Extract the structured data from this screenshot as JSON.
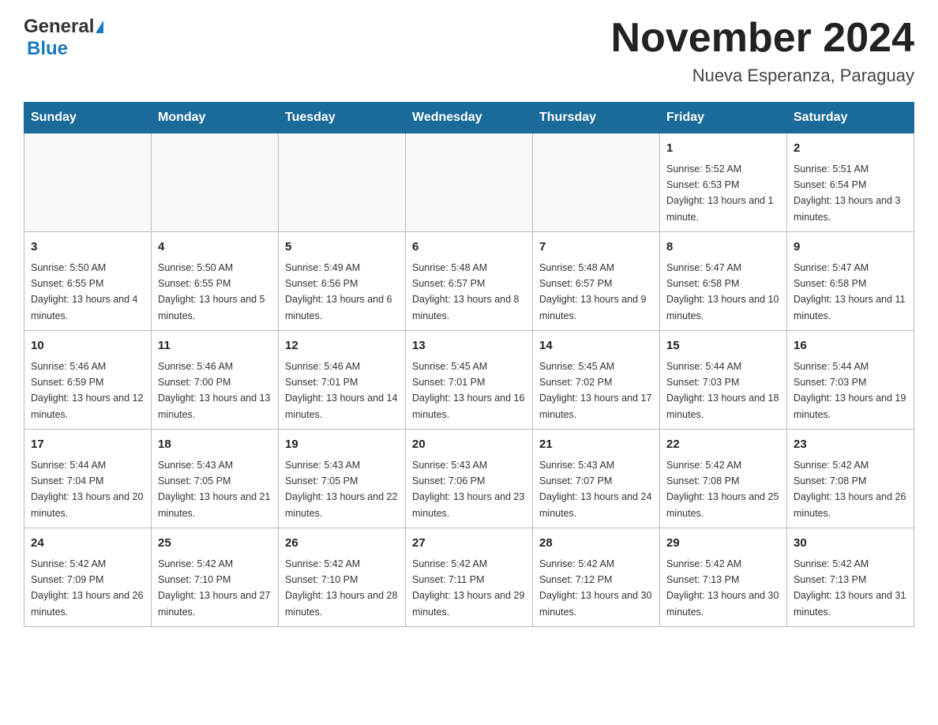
{
  "header": {
    "logo_general": "General",
    "logo_blue": "Blue",
    "month_title": "November 2024",
    "location": "Nueva Esperanza, Paraguay"
  },
  "weekdays": [
    "Sunday",
    "Monday",
    "Tuesday",
    "Wednesday",
    "Thursday",
    "Friday",
    "Saturday"
  ],
  "weeks": [
    [
      {
        "day": "",
        "info": ""
      },
      {
        "day": "",
        "info": ""
      },
      {
        "day": "",
        "info": ""
      },
      {
        "day": "",
        "info": ""
      },
      {
        "day": "",
        "info": ""
      },
      {
        "day": "1",
        "info": "Sunrise: 5:52 AM\nSunset: 6:53 PM\nDaylight: 13 hours and 1 minute."
      },
      {
        "day": "2",
        "info": "Sunrise: 5:51 AM\nSunset: 6:54 PM\nDaylight: 13 hours and 3 minutes."
      }
    ],
    [
      {
        "day": "3",
        "info": "Sunrise: 5:50 AM\nSunset: 6:55 PM\nDaylight: 13 hours and 4 minutes."
      },
      {
        "day": "4",
        "info": "Sunrise: 5:50 AM\nSunset: 6:55 PM\nDaylight: 13 hours and 5 minutes."
      },
      {
        "day": "5",
        "info": "Sunrise: 5:49 AM\nSunset: 6:56 PM\nDaylight: 13 hours and 6 minutes."
      },
      {
        "day": "6",
        "info": "Sunrise: 5:48 AM\nSunset: 6:57 PM\nDaylight: 13 hours and 8 minutes."
      },
      {
        "day": "7",
        "info": "Sunrise: 5:48 AM\nSunset: 6:57 PM\nDaylight: 13 hours and 9 minutes."
      },
      {
        "day": "8",
        "info": "Sunrise: 5:47 AM\nSunset: 6:58 PM\nDaylight: 13 hours and 10 minutes."
      },
      {
        "day": "9",
        "info": "Sunrise: 5:47 AM\nSunset: 6:58 PM\nDaylight: 13 hours and 11 minutes."
      }
    ],
    [
      {
        "day": "10",
        "info": "Sunrise: 5:46 AM\nSunset: 6:59 PM\nDaylight: 13 hours and 12 minutes."
      },
      {
        "day": "11",
        "info": "Sunrise: 5:46 AM\nSunset: 7:00 PM\nDaylight: 13 hours and 13 minutes."
      },
      {
        "day": "12",
        "info": "Sunrise: 5:46 AM\nSunset: 7:01 PM\nDaylight: 13 hours and 14 minutes."
      },
      {
        "day": "13",
        "info": "Sunrise: 5:45 AM\nSunset: 7:01 PM\nDaylight: 13 hours and 16 minutes."
      },
      {
        "day": "14",
        "info": "Sunrise: 5:45 AM\nSunset: 7:02 PM\nDaylight: 13 hours and 17 minutes."
      },
      {
        "day": "15",
        "info": "Sunrise: 5:44 AM\nSunset: 7:03 PM\nDaylight: 13 hours and 18 minutes."
      },
      {
        "day": "16",
        "info": "Sunrise: 5:44 AM\nSunset: 7:03 PM\nDaylight: 13 hours and 19 minutes."
      }
    ],
    [
      {
        "day": "17",
        "info": "Sunrise: 5:44 AM\nSunset: 7:04 PM\nDaylight: 13 hours and 20 minutes."
      },
      {
        "day": "18",
        "info": "Sunrise: 5:43 AM\nSunset: 7:05 PM\nDaylight: 13 hours and 21 minutes."
      },
      {
        "day": "19",
        "info": "Sunrise: 5:43 AM\nSunset: 7:05 PM\nDaylight: 13 hours and 22 minutes."
      },
      {
        "day": "20",
        "info": "Sunrise: 5:43 AM\nSunset: 7:06 PM\nDaylight: 13 hours and 23 minutes."
      },
      {
        "day": "21",
        "info": "Sunrise: 5:43 AM\nSunset: 7:07 PM\nDaylight: 13 hours and 24 minutes."
      },
      {
        "day": "22",
        "info": "Sunrise: 5:42 AM\nSunset: 7:08 PM\nDaylight: 13 hours and 25 minutes."
      },
      {
        "day": "23",
        "info": "Sunrise: 5:42 AM\nSunset: 7:08 PM\nDaylight: 13 hours and 26 minutes."
      }
    ],
    [
      {
        "day": "24",
        "info": "Sunrise: 5:42 AM\nSunset: 7:09 PM\nDaylight: 13 hours and 26 minutes."
      },
      {
        "day": "25",
        "info": "Sunrise: 5:42 AM\nSunset: 7:10 PM\nDaylight: 13 hours and 27 minutes."
      },
      {
        "day": "26",
        "info": "Sunrise: 5:42 AM\nSunset: 7:10 PM\nDaylight: 13 hours and 28 minutes."
      },
      {
        "day": "27",
        "info": "Sunrise: 5:42 AM\nSunset: 7:11 PM\nDaylight: 13 hours and 29 minutes."
      },
      {
        "day": "28",
        "info": "Sunrise: 5:42 AM\nSunset: 7:12 PM\nDaylight: 13 hours and 30 minutes."
      },
      {
        "day": "29",
        "info": "Sunrise: 5:42 AM\nSunset: 7:13 PM\nDaylight: 13 hours and 30 minutes."
      },
      {
        "day": "30",
        "info": "Sunrise: 5:42 AM\nSunset: 7:13 PM\nDaylight: 13 hours and 31 minutes."
      }
    ]
  ]
}
